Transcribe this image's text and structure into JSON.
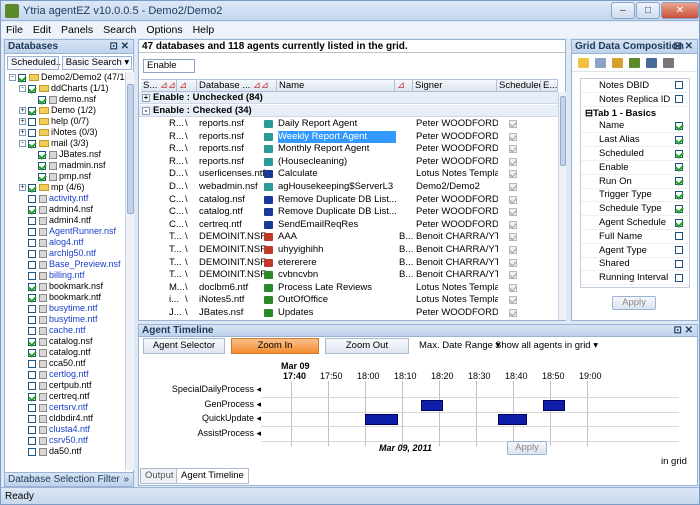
{
  "window": {
    "title": "Ytria agentEZ v10.0.0.5 - Demo2/Demo2"
  },
  "menu": [
    "File",
    "Edit",
    "Panels",
    "Search",
    "Options",
    "Help"
  ],
  "left_panel": {
    "title": "Databases",
    "combo1": "Scheduled...",
    "combo2": "Basic Search",
    "footer": "Database Selection Filter",
    "tree": [
      {
        "label": "Demo2/Demo2 (47/1",
        "kind": "folder",
        "indent": 0,
        "checked": true,
        "link": false,
        "toggle": "-"
      },
      {
        "label": "ddCharts (1/1)",
        "kind": "folder",
        "indent": 1,
        "checked": true,
        "link": false,
        "toggle": "-"
      },
      {
        "label": "demo.nsf",
        "kind": "db",
        "indent": 2,
        "checked": true,
        "link": false
      },
      {
        "label": "Demo (1/2)",
        "kind": "folder",
        "indent": 1,
        "checked": true,
        "link": false,
        "toggle": "+"
      },
      {
        "label": "help (0/7)",
        "kind": "folder",
        "indent": 1,
        "checked": false,
        "link": false,
        "toggle": "+"
      },
      {
        "label": "iNotes (0/3)",
        "kind": "folder",
        "indent": 1,
        "checked": false,
        "link": false,
        "toggle": "+"
      },
      {
        "label": "mail (3/3)",
        "kind": "folder",
        "indent": 1,
        "checked": true,
        "link": false,
        "toggle": "-"
      },
      {
        "label": "JBates.nsf",
        "kind": "db",
        "indent": 2,
        "checked": true,
        "link": false
      },
      {
        "label": "madmin.nsf",
        "kind": "db",
        "indent": 2,
        "checked": true,
        "link": false
      },
      {
        "label": "pmp.nsf",
        "kind": "db",
        "indent": 2,
        "checked": true,
        "link": false
      },
      {
        "label": "mp (4/6)",
        "kind": "folder",
        "indent": 1,
        "checked": true,
        "link": false,
        "toggle": "+"
      },
      {
        "label": "activity.ntf",
        "kind": "db",
        "indent": 1,
        "checked": false,
        "link": true
      },
      {
        "label": "admin4.nsf",
        "kind": "db",
        "indent": 1,
        "checked": true,
        "link": false
      },
      {
        "label": "admin4.ntf",
        "kind": "db",
        "indent": 1,
        "checked": false,
        "link": false
      },
      {
        "label": "AgentRunner.nsf",
        "kind": "db",
        "indent": 1,
        "checked": false,
        "link": true
      },
      {
        "label": "alog4.ntf",
        "kind": "db",
        "indent": 1,
        "checked": false,
        "link": true
      },
      {
        "label": "archlg50.ntf",
        "kind": "db",
        "indent": 1,
        "checked": false,
        "link": true
      },
      {
        "label": "Base_Preview.nsf",
        "kind": "db",
        "indent": 1,
        "checked": false,
        "link": true
      },
      {
        "label": "billing.ntf",
        "kind": "db",
        "indent": 1,
        "checked": false,
        "link": true
      },
      {
        "label": "bookmark.nsf",
        "kind": "db",
        "indent": 1,
        "checked": true,
        "link": false
      },
      {
        "label": "bookmark.ntf",
        "kind": "db",
        "indent": 1,
        "checked": true,
        "link": false
      },
      {
        "label": "busytime.ntf",
        "kind": "db",
        "indent": 1,
        "checked": false,
        "link": true
      },
      {
        "label": "busytime.ntf",
        "kind": "db",
        "indent": 1,
        "checked": false,
        "link": true
      },
      {
        "label": "cache.ntf",
        "kind": "db",
        "indent": 1,
        "checked": false,
        "link": true
      },
      {
        "label": "catalog.nsf",
        "kind": "db",
        "indent": 1,
        "checked": true,
        "link": false
      },
      {
        "label": "catalog.ntf",
        "kind": "db",
        "indent": 1,
        "checked": true,
        "link": false
      },
      {
        "label": "cca50.ntf",
        "kind": "db",
        "indent": 1,
        "checked": false,
        "link": false
      },
      {
        "label": "certlog.ntf",
        "kind": "db",
        "indent": 1,
        "checked": false,
        "link": true
      },
      {
        "label": "certpub.ntf",
        "kind": "db",
        "indent": 1,
        "checked": false,
        "link": false
      },
      {
        "label": "certreq.ntf",
        "kind": "db",
        "indent": 1,
        "checked": true,
        "link": false
      },
      {
        "label": "certsrv.ntf",
        "kind": "db",
        "indent": 1,
        "checked": false,
        "link": true
      },
      {
        "label": "cldbdir4.ntf",
        "kind": "db",
        "indent": 1,
        "checked": false,
        "link": false
      },
      {
        "label": "clusta4.ntf",
        "kind": "db",
        "indent": 1,
        "checked": false,
        "link": true
      },
      {
        "label": "csrv50.ntf",
        "kind": "db",
        "indent": 1,
        "checked": false,
        "link": true
      },
      {
        "label": "da50.ntf",
        "kind": "db",
        "indent": 1,
        "checked": false,
        "link": false
      }
    ]
  },
  "grid": {
    "info": "47 databases and 118 agents currently listed in the grid.",
    "filter_value": "Enable",
    "columns": [
      "S...",
      "Database ...",
      "Name",
      "Signer",
      "Scheduled",
      "E..."
    ],
    "groups": [
      {
        "label": "Enable : Unchecked (84)",
        "expanded": false
      },
      {
        "label": "Enable : Checked (34)",
        "expanded": true
      }
    ],
    "rows": [
      {
        "s": "R...",
        "sep": "\\",
        "db": "reports.nsf",
        "name": "Daily Report Agent",
        "icon": "#2a9a9a",
        "b": "",
        "signer": "Peter WOODFORD/Y...",
        "sched": true,
        "sel": false
      },
      {
        "s": "R...",
        "sep": "\\",
        "db": "reports.nsf",
        "name": "Weekly Report Agent",
        "icon": "#2a9a9a",
        "b": "",
        "signer": "Peter WOODFORD/Y...",
        "sched": true,
        "sel": true
      },
      {
        "s": "R...",
        "sep": "\\",
        "db": "reports.nsf",
        "name": "Monthly Report Agent",
        "icon": "#2a9a9a",
        "b": "",
        "signer": "Peter WOODFORD/Y...",
        "sched": true,
        "sel": false
      },
      {
        "s": "R...",
        "sep": "\\",
        "db": "reports.nsf",
        "name": "(Housecleaning)",
        "icon": "#2a9a9a",
        "b": "",
        "signer": "Peter WOODFORD/Y...",
        "sched": true,
        "sel": false
      },
      {
        "s": "D...",
        "sep": "\\",
        "db": "userlicenses.ntf",
        "name": "Calculate",
        "icon": "#1a3a9a",
        "b": "",
        "signer": "Lotus Notes Templa...",
        "sched": true,
        "sel": false
      },
      {
        "s": "D...",
        "sep": "\\",
        "db": "webadmin.nsf",
        "name": "agHousekeeping$ServerL3",
        "icon": "#2a9a9a",
        "b": "",
        "signer": "Demo2/Demo2",
        "sched": true,
        "sel": false
      },
      {
        "s": "C...",
        "sep": "\\",
        "db": "catalog.nsf",
        "name": "Remove Duplicate DB List...",
        "icon": "#1a3a9a",
        "b": "",
        "signer": "Peter WOODFORD/Y...",
        "sched": true,
        "sel": false
      },
      {
        "s": "C...",
        "sep": "\\",
        "db": "catalog.ntf",
        "name": "Remove Duplicate DB List...",
        "icon": "#1a3a9a",
        "b": "",
        "signer": "Peter WOODFORD/Y...",
        "sched": true,
        "sel": false
      },
      {
        "s": "C...",
        "sep": "\\",
        "db": "certreq.ntf",
        "name": "SendEmailReqRes",
        "icon": "#1a3a9a",
        "b": "",
        "signer": "Peter WOODFORD/Y...",
        "sched": true,
        "sel": false
      },
      {
        "s": "T...",
        "sep": "\\",
        "db": "DEMOINIT.NSF",
        "name": "AAA",
        "icon": "#c0392b",
        "b": "B...",
        "signer": "Benoit CHARRA/YT...",
        "sched": true,
        "sel": false
      },
      {
        "s": "T...",
        "sep": "\\",
        "db": "DEMOINIT.NSF",
        "name": "uhyyighihh",
        "icon": "#c0392b",
        "b": "B...",
        "signer": "Benoit CHARRA/YT...",
        "sched": true,
        "sel": false
      },
      {
        "s": "T...",
        "sep": "\\",
        "db": "DEMOINIT.NSF",
        "name": "etererere",
        "icon": "#c0392b",
        "b": "B...",
        "signer": "Benoit CHARRA/YT...",
        "sched": true,
        "sel": false
      },
      {
        "s": "T...",
        "sep": "\\",
        "db": "DEMOINIT.NSF",
        "name": "cvbncvbn",
        "icon": "#2a8a2a",
        "b": "B...",
        "signer": "Benoit CHARRA/YT...",
        "sched": true,
        "sel": false
      },
      {
        "s": "M...",
        "sep": "\\",
        "db": "doclbm6.ntf",
        "name": "Process Late Reviews",
        "icon": "#2a8a2a",
        "b": "",
        "signer": "Lotus Notes Templa...",
        "sched": true,
        "sel": false
      },
      {
        "s": "i...",
        "sep": "\\",
        "db": "iNotes5.ntf",
        "name": "OutOfOffice",
        "icon": "#2a8a2a",
        "b": "",
        "signer": "Lotus Notes Templa...",
        "sched": true,
        "sel": false
      },
      {
        "s": "J...",
        "sep": "\\",
        "db": "JBates.nsf",
        "name": "Updates",
        "icon": "#2a8a2a",
        "b": "",
        "signer": "Peter WOODFORD/Y...",
        "sched": true,
        "sel": false
      }
    ]
  },
  "right_panel": {
    "title": "Grid Data Composition",
    "pre_items": [
      {
        "label": "Notes DBID",
        "checked": false
      },
      {
        "label": "Notes Replica ID",
        "checked": false
      }
    ],
    "tab_label": "Tab 1 - Basics",
    "items": [
      {
        "label": "Name",
        "checked": true
      },
      {
        "label": "Last Alias",
        "checked": true
      },
      {
        "label": "Scheduled",
        "checked": true
      },
      {
        "label": "Enable",
        "checked": true
      },
      {
        "label": "Run On",
        "checked": true
      },
      {
        "label": "Trigger Type",
        "checked": true
      },
      {
        "label": "Schedule Type",
        "checked": true
      },
      {
        "label": "Agent Schedule",
        "checked": true
      },
      {
        "label": "Full Name",
        "checked": false
      },
      {
        "label": "Agent Type",
        "checked": false
      },
      {
        "label": "Shared",
        "checked": false
      },
      {
        "label": "Running Interval",
        "checked": false
      }
    ],
    "apply_label": "Apply"
  },
  "timeline": {
    "title": "Agent Timeline",
    "buttons": {
      "selector": "Agent Selector",
      "zoom_in": "Zoom In",
      "zoom_out": "Zoom Out"
    },
    "max_date_range": "Max. Date Range",
    "show_all": "Show all agents in grid",
    "top_date": "Mar 09",
    "times": [
      "17:40",
      "17:50",
      "18:00",
      "18:10",
      "18:20",
      "18:30",
      "18:40",
      "18:50",
      "19:00"
    ],
    "date_label": "Mar 09, 2011",
    "apply_label": "Apply",
    "partial_text": "in grid",
    "agents": [
      {
        "name": "SpecialDailyProcess",
        "bars": []
      },
      {
        "name": "GenProcess",
        "bars": [
          [
            18.25,
            18.35
          ],
          [
            18.8,
            18.9
          ]
        ]
      },
      {
        "name": "QuickUpdate",
        "bars": [
          [
            18.0,
            18.15
          ],
          [
            18.6,
            18.73
          ]
        ]
      },
      {
        "name": "AssistProcess",
        "bars": []
      }
    ]
  },
  "bottom_tabs": [
    "Output",
    "Agent Timeline"
  ],
  "status": "Ready"
}
